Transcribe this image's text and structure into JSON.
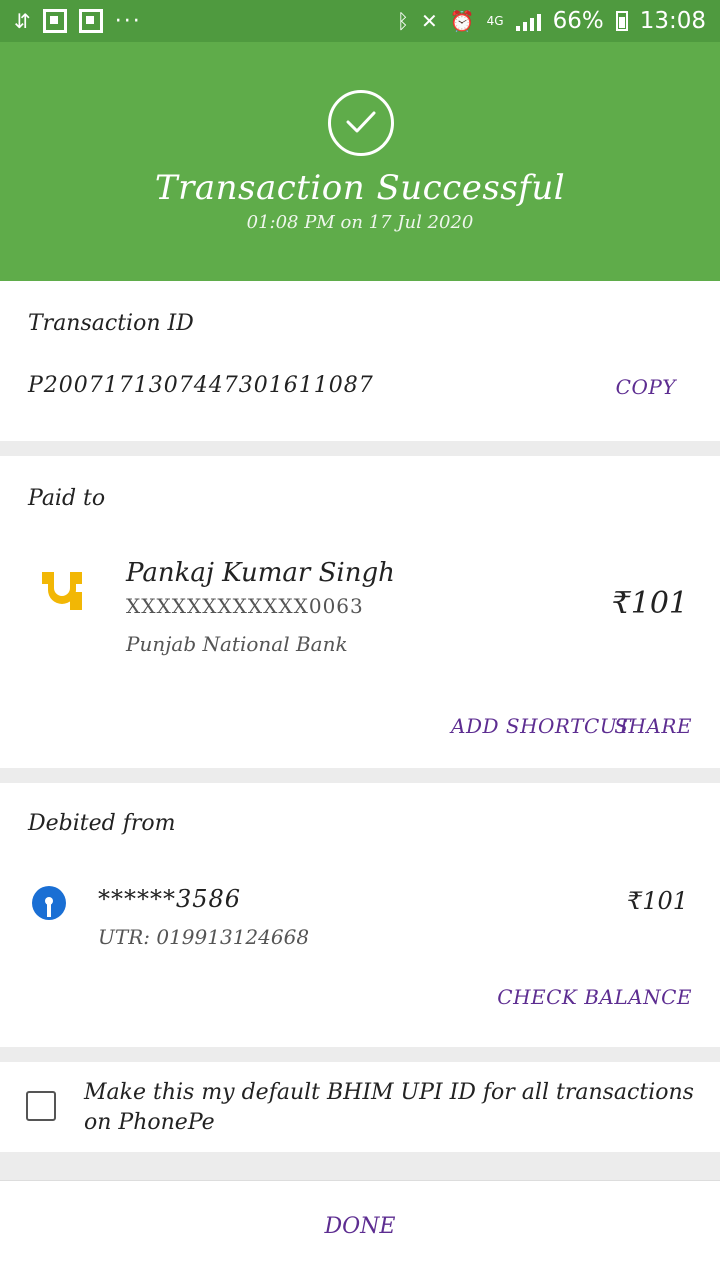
{
  "status_bar": {
    "dots": "···",
    "network": "4G",
    "battery_percent": "66%",
    "time": "13:08",
    "icons": [
      "usb-icon",
      "notification-icon",
      "notification-icon",
      "bluetooth-icon",
      "mute-icon",
      "alarm-icon",
      "signal-icon",
      "battery-icon"
    ]
  },
  "header": {
    "title": "Transaction Successful",
    "subtitle": "01:08 PM on 17 Jul 2020",
    "icon": "check-circle-icon",
    "background_color": "#5fac4a"
  },
  "transaction": {
    "label": "Transaction ID",
    "id": "P2007171307447301611087",
    "copy_label": "COPY"
  },
  "paid_to": {
    "label": "Paid to",
    "name": "Pankaj Kumar Singh",
    "account": "XXXXXXXXXXXX0063",
    "bank": "Punjab National Bank",
    "amount": "₹101",
    "bank_icon": "pnb-logo-icon",
    "add_shortcut_label": "ADD SHORTCUT",
    "share_label": "SHARE"
  },
  "debited_from": {
    "label": "Debited from",
    "account": "******3586",
    "utr": "UTR: 019913124668",
    "amount": "₹101",
    "bank_icon": "sbi-logo-icon",
    "check_balance_label": "CHECK BALANCE"
  },
  "default_option": {
    "text": "Make this my default BHIM UPI ID for all transactions on PhonePe",
    "checked": false
  },
  "footer": {
    "done_label": "DONE"
  },
  "colors": {
    "accent": "#5d2d91",
    "status_bar": "#4f9a3f",
    "divider": "#ececec"
  }
}
